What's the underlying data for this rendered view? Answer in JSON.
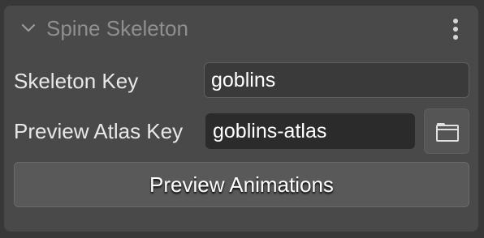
{
  "panel": {
    "title": "Spine Skeleton",
    "collapse_icon": "chevron-down-icon",
    "menu_icon": "more-vertical-icon"
  },
  "fields": {
    "skeleton_key": {
      "label": "Skeleton Key",
      "value": "goblins"
    },
    "preview_atlas_key": {
      "label": "Preview Atlas Key",
      "value": "goblins-atlas",
      "browse_icon": "folder-icon"
    }
  },
  "actions": {
    "preview_animations_label": "Preview Animations"
  },
  "colors": {
    "background": "#383838",
    "panel": "#494949",
    "title_text": "#8f8f8f",
    "label_text": "#e8e8e8",
    "input_dark": "#2b2b2b",
    "button": "#595959"
  }
}
